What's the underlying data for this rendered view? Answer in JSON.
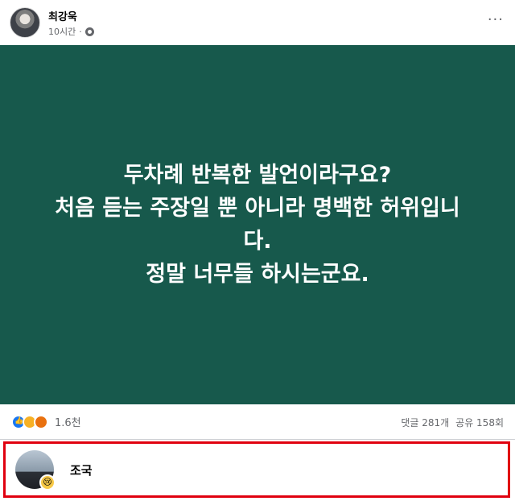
{
  "post": {
    "author": "최강욱",
    "time": "10시간",
    "more_label": "···",
    "text": "두차례 반복한 발언이라구요?\n처음 듣는 주장일 뿐 아니라 명백한 허위입니\n다.\n정말 너무들 하시는군요."
  },
  "stats": {
    "reaction_count": "1.6천",
    "comments": "댓글 281개",
    "shares": "공유 158회"
  },
  "comment": {
    "author": "조국",
    "emoji": "😢"
  },
  "colors": {
    "image_background": "#17594c",
    "highlight_border": "#e0000f"
  }
}
